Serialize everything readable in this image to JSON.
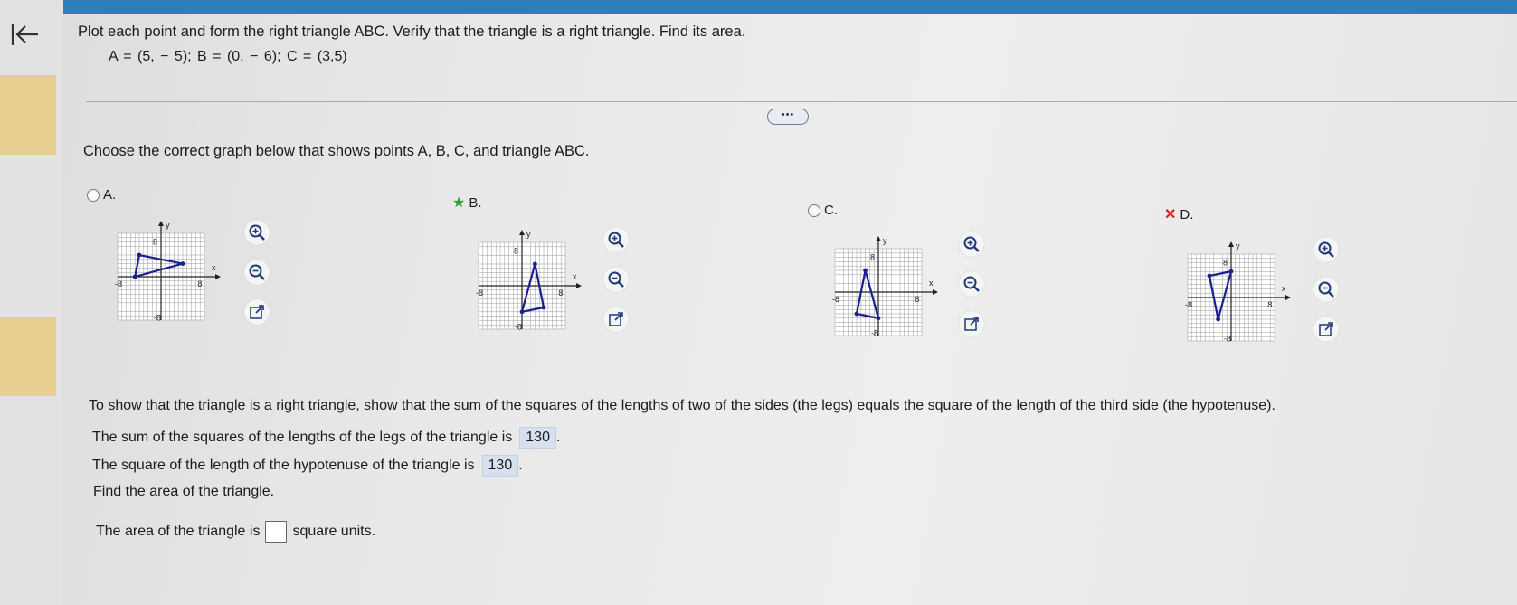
{
  "header": {
    "prompt": "Plot each point and form the right triangle ABC. Verify that the triangle is a right triangle. Find its area.",
    "points": "A = (5, − 5);   B = (0, − 6);   C = (3,5)",
    "more_label": "•••"
  },
  "question": "Choose the correct graph below that shows points A, B, C, and triangle ABC.",
  "options": [
    {
      "letter": "A.",
      "state": "unselected"
    },
    {
      "letter": "B.",
      "state": "correct"
    },
    {
      "letter": "C.",
      "state": "unselected"
    },
    {
      "letter": "D.",
      "state": "incorrect"
    }
  ],
  "graph_labels": {
    "y": "y",
    "x": "x",
    "top": "8",
    "left": "-8",
    "right": "8",
    "bottom": "-8"
  },
  "icons": {
    "back": "back-to-start-icon",
    "zoom_in": "zoom-in-icon",
    "zoom_out": "zoom-out-icon",
    "popout": "pop-out-icon"
  },
  "explanation": "To show that the triangle is a right triangle, show that the sum of the squares of the lengths of two of the sides (the legs) equals the square of the length of the third side (the hypotenuse).",
  "legs_sum": {
    "prefix": "The sum of the squares of the lengths of the legs of the triangle is",
    "value": "130",
    "suffix": "."
  },
  "hyp_square": {
    "prefix": "The square of the length of the hypotenuse of the triangle is",
    "value": "130",
    "suffix": "."
  },
  "find_area": "Find the area of the triangle.",
  "area_line": {
    "prefix": "The area of the triangle is",
    "suffix": "square units."
  },
  "colors": {
    "accent": "#2d7fb8",
    "triangle": "#1a1f8c",
    "correct": "#2aa032",
    "wrong": "#d42323",
    "answer_bg": "#d7e0ee"
  }
}
